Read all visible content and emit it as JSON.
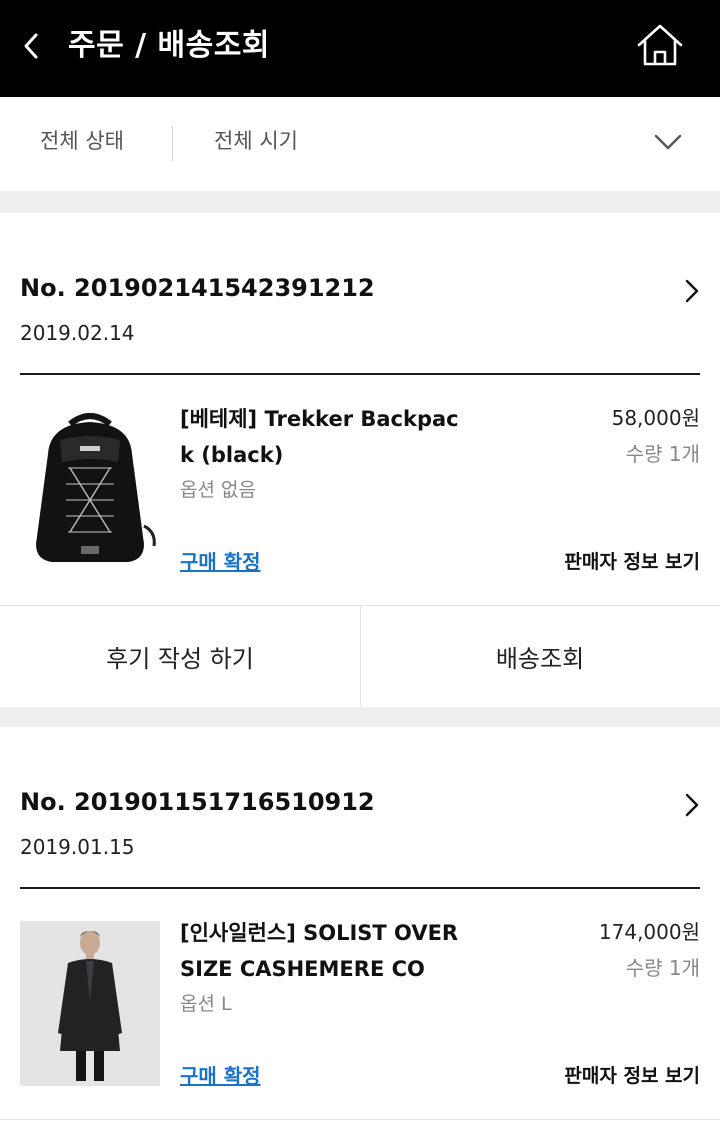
{
  "header": {
    "title": "주문 / 배송조회",
    "back_icon": "chevron-left-icon",
    "home_icon": "home-icon"
  },
  "filters": {
    "status_label": "전체 상태",
    "period_label": "전체 시기",
    "expand_icon": "chevron-down-icon"
  },
  "orders": [
    {
      "order_no": "No. 2019021415423912​12",
      "date": "2019.02.14",
      "item": {
        "name": "[베테제] Trekker Backpack (black)",
        "option": "옵션 없음",
        "price": "58,000원",
        "quantity": "수량 1개",
        "thumbnail_icon": "backpack-photo",
        "confirm_label": "구매 확정",
        "seller_label": "판매자 정보 보기"
      },
      "actions": [
        "후기 작성 하기",
        "배송조회"
      ]
    },
    {
      "order_no": "No. 201901151716510912",
      "date": "2019.01.15",
      "item": {
        "name": "[인사일런스] SOLIST OVERSIZE CASHEMERE CO",
        "option": "옵션 L",
        "price": "174,000원",
        "quantity": "수량 1개",
        "thumbnail_icon": "coat-model-photo",
        "confirm_label": "구매 확정",
        "seller_label": "판매자 정보 보기"
      }
    }
  ],
  "colors": {
    "header_bg": "#000000",
    "link_blue": "#1a73c8",
    "gap_gray": "#efefef"
  }
}
